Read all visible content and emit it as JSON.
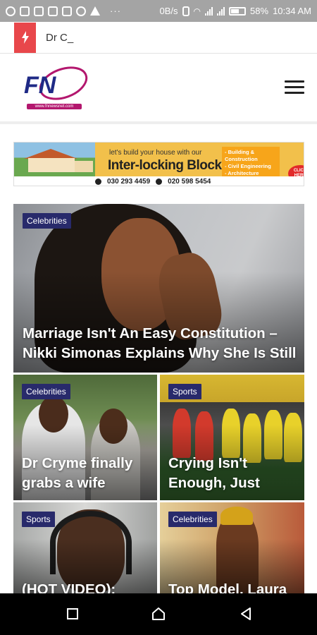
{
  "status_bar": {
    "network_speed": "0B/s",
    "battery_percent": "58%",
    "time": "10:34 AM",
    "left_icons": [
      "opera-icon",
      "facebook-icon",
      "instagram-icon",
      "gallery-icon",
      "mail-icon",
      "shield-icon",
      "warning-icon"
    ],
    "more": "···"
  },
  "breaking_news": {
    "icon": "lightning-icon",
    "text": "Dr C_"
  },
  "header": {
    "logo_text": "FN",
    "logo_url_text": "www.fnnewsnet.com",
    "menu_icon": "hamburger-icon"
  },
  "ad_banner": {
    "tagline": "let's build your house with our",
    "title": "Inter-locking Blocks",
    "services": [
      "- Building & Construction",
      "- Civil Engineering",
      "- Architecture"
    ],
    "cta": "CLICK HERE",
    "phone_1": "030 293 4459",
    "phone_2": "020 598 5454"
  },
  "articles": [
    {
      "category": "Celebrities",
      "title": "Marriage Isn't An Easy Constitution – Nikki Simonas Explains Why She Is Still"
    },
    {
      "category": "Celebrities",
      "title": "Dr Cryme finally grabs a wife"
    },
    {
      "category": "Sports",
      "title": "Crying Isn't Enough, Just"
    },
    {
      "category": "Sports",
      "title": "(HOT VIDEO):"
    },
    {
      "category": "Celebrities",
      "title": "Top Model, Laura"
    }
  ],
  "colors": {
    "breaking_accent": "#e8474b",
    "badge_bg": "#282a6b",
    "logo_blue": "#1f2a86",
    "logo_pink": "#b3176e"
  },
  "nav_bar": {
    "buttons": [
      "recents-icon",
      "home-icon",
      "back-icon"
    ]
  }
}
